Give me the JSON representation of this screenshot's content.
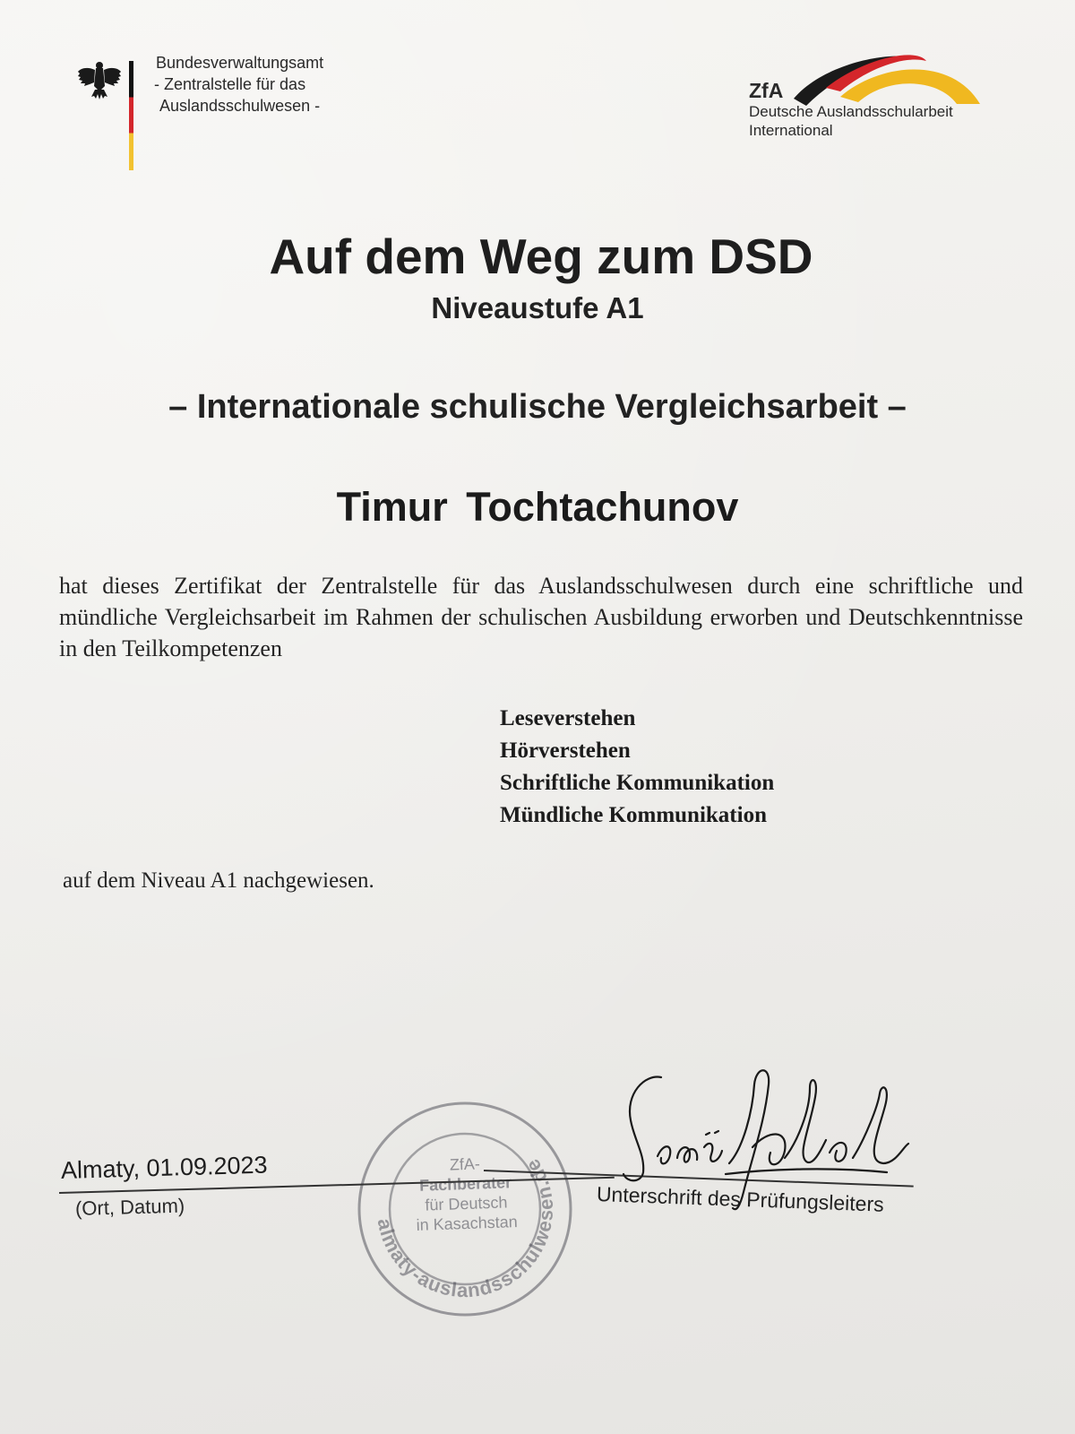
{
  "header": {
    "authority": {
      "line1": "Bundesverwaltungsamt",
      "line2": "- Zentralstelle für das",
      "line3": "Auslandsschulwesen -"
    },
    "zfa": {
      "abbr": "ZfA",
      "line1": "Deutsche Auslandsschularbeit",
      "line2": "International"
    }
  },
  "certificate": {
    "title": "Auf dem Weg zum DSD",
    "subtitle": "Niveaustufe A1",
    "type": "– Internationale schulische Vergleichsarbeit –",
    "candidate_name": "Timur  Tochtachunov",
    "body": "hat dieses Zertifikat der Zentralstelle für das Auslandsschulwesen durch eine schriftliche und mündliche Vergleichsarbeit im Rahmen der schulischen Ausbildung erworben und Deutschkenntnisse in den Teilkompetenzen",
    "competencies": [
      "Leseverstehen",
      "Hörverstehen",
      "Schriftliche Kommunikation",
      "Mündliche Kommunikation"
    ],
    "closing": "auf dem Niveau A1 nachgewiesen."
  },
  "footer": {
    "place_date": "Almaty, 01.09.2023",
    "place_date_caption": "(Ort, Datum)",
    "signature_caption": "Unterschrift des Prüfungsleiters",
    "stamp": {
      "ring_text": "almaty-auslandsschulwesen.de",
      "line1": "ZfA-",
      "line2": "Fachberater",
      "line3": "für Deutsch",
      "line4": "in Kasachstan"
    }
  }
}
